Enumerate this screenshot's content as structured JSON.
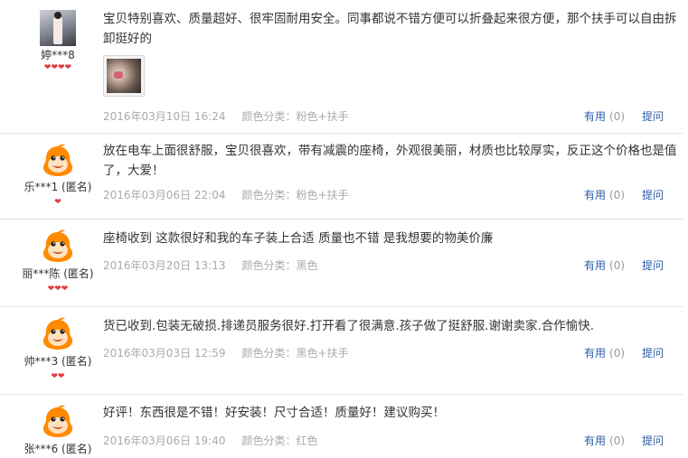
{
  "reviews": [
    {
      "nick": "婷***8",
      "avatar": "user-photo",
      "stars": "❤❤❤❤",
      "content": "宝贝特别喜欢、质量超好、很牢固耐用安全。同事都说不错方便可以折叠起来很方便，那个扶手可以自由拆卸挺好的",
      "has_photo": true,
      "date": "2016年03月10日 16:24",
      "spec": "颜色分类：粉色+扶手",
      "useful_label": "有用",
      "useful_count": "(0)",
      "ask_label": "提问"
    },
    {
      "nick": "乐***1 (匿名)",
      "avatar": "default-mascot",
      "stars": "❤",
      "content": "放在电车上面很舒服，宝贝很喜欢，带有减震的座椅，外观很美丽，材质也比较厚实，反正这个价格也是值了，大爱！",
      "date": "2016年03月06日 22:04",
      "spec": "颜色分类：粉色+扶手",
      "useful_label": "有用",
      "useful_count": "(0)",
      "ask_label": "提问"
    },
    {
      "nick": "丽***陈 (匿名)",
      "avatar": "default-mascot",
      "stars": "❤❤❤",
      "content": "座椅收到 这款很好和我的车子装上合适 质量也不错 是我想要的物美价廉",
      "date": "2016年03月20日 13:13",
      "spec": "颜色分类：黑色",
      "useful_label": "有用",
      "useful_count": "(0)",
      "ask_label": "提问"
    },
    {
      "nick": "帅***3 (匿名)",
      "avatar": "default-mascot",
      "stars": "❤❤",
      "content": "货已收到.包装无破损.排递员服务很好.打开看了很满意.孩子做了挺舒服.谢谢卖家.合作愉快.",
      "date": "2016年03月03日 12:59",
      "spec": "颜色分类：黑色+扶手",
      "useful_label": "有用",
      "useful_count": "(0)",
      "ask_label": "提问"
    },
    {
      "nick": "张***6 (匿名)",
      "avatar": "default-mascot",
      "stars": "",
      "content": "好评！东西很是不错！好安装！尺寸合适！质量好！建议购买！",
      "date": "2016年03月06日 19:40",
      "spec": "颜色分类：红色",
      "useful_label": "有用",
      "useful_count": "(0)",
      "ask_label": "提问"
    }
  ],
  "colors": {
    "link": "#2a5ca8",
    "meta": "#aaaaaa",
    "heart": "#e5383b",
    "mascot": "#ff8a00",
    "divider": "#e4e4e4"
  }
}
